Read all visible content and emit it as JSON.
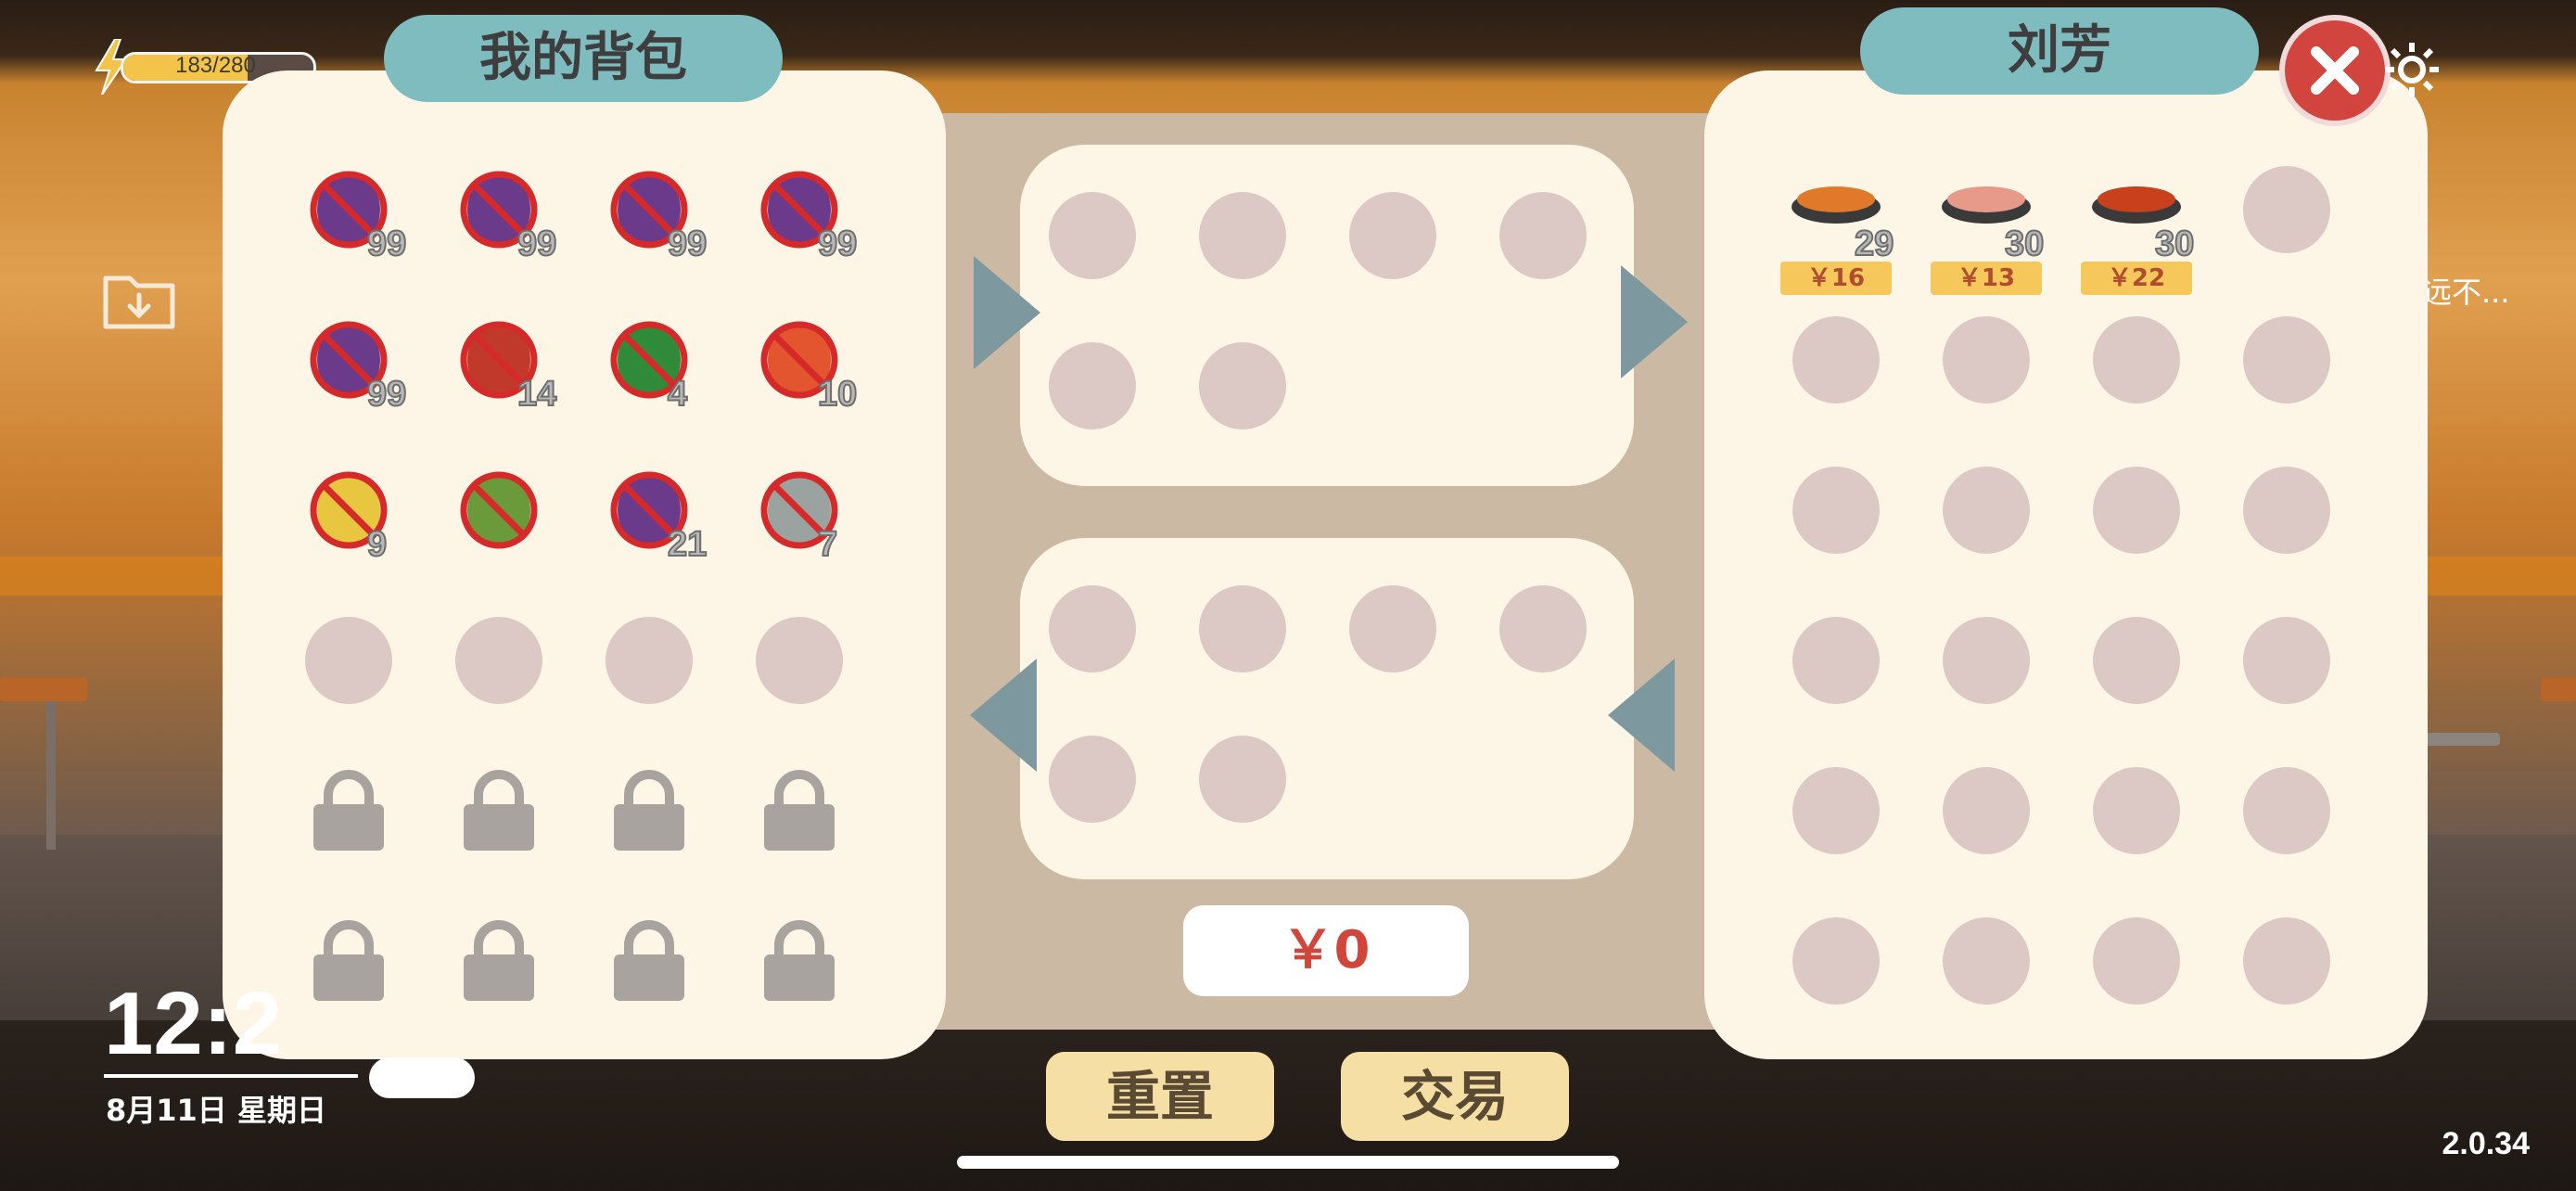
{
  "hud": {
    "energy": {
      "current": 183,
      "max": 280,
      "label": "183/280"
    },
    "time": "12:2",
    "date": "8月11日 星期日",
    "version": "2.0.34",
    "side_text": "远不..."
  },
  "left_panel": {
    "title": "我的背包",
    "items": [
      {
        "icon": "eggplant-icon",
        "count": "99"
      },
      {
        "icon": "eggplant-icon",
        "count": "99"
      },
      {
        "icon": "eggplant-icon",
        "count": "99"
      },
      {
        "icon": "eggplant-icon",
        "count": "99"
      },
      {
        "icon": "eggplant-icon",
        "count": "99"
      },
      {
        "icon": "chili-pepper-icon",
        "count": "14"
      },
      {
        "icon": "watermelon-icon",
        "count": "4"
      },
      {
        "icon": "tomato-icon",
        "count": "10"
      },
      {
        "icon": "corn-icon",
        "count": "9"
      },
      {
        "icon": "cabbage-icon",
        "count": ""
      },
      {
        "icon": "eggplant-icon",
        "count": "21"
      },
      {
        "icon": "cooking-pot-icon",
        "count": "7"
      }
    ],
    "empty_slots": 4,
    "locked_slots": 8
  },
  "trade": {
    "offer_slots": 6,
    "receive_slots": 6,
    "total": "￥0",
    "reset_label": "重置",
    "trade_label": "交易"
  },
  "right_panel": {
    "title": "刘芳",
    "items": [
      {
        "icon": "stir-fry-dish-icon",
        "count": "29",
        "price": "￥16",
        "color": "#e07a2a"
      },
      {
        "icon": "noodle-dish-icon",
        "count": "30",
        "price": "￥13",
        "color": "#e79a8a"
      },
      {
        "icon": "chili-stir-fry-icon",
        "count": "30",
        "price": "￥22",
        "color": "#c8401c"
      }
    ],
    "empty_slots": 21
  },
  "colors": {
    "panel_bg": "#fdf6e6",
    "title_pill": "#7fbcc0",
    "slot": "#dcc9c6",
    "price_tag": "#f6c75a",
    "button": "#f5dfa4",
    "close_red": "#d2453f",
    "arrow": "#7e98a0"
  }
}
